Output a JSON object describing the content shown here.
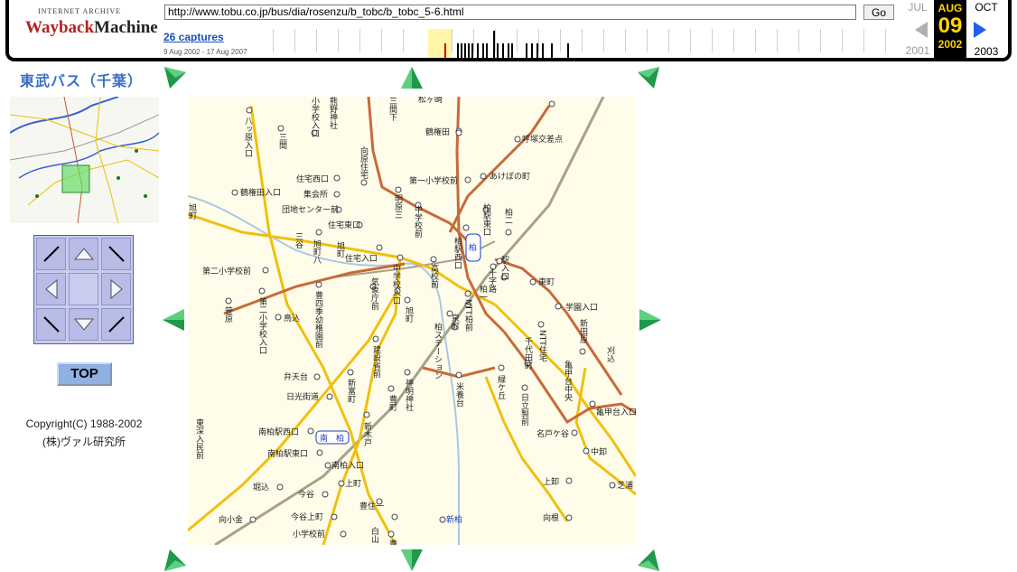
{
  "wayback": {
    "logo_top": "INTERNET ARCHIVE",
    "logo_main_a": "Wayback",
    "logo_main_b": "Machine",
    "url": "http://www.tobu.co.jp/bus/dia/rosenzu/b_tobc/b_tobc_5-6.html",
    "go_label": "Go",
    "captures_label": "26 captures",
    "date_range": "9 Aug 2002 - 17 Aug 2007",
    "prev_month": "JUL",
    "cur_month": "AUG",
    "cur_day": "09",
    "cur_year": "2002",
    "next_month": "OCT",
    "prev_year": "2001",
    "next_year": "2003"
  },
  "page": {
    "title": "東武バス（千葉）",
    "top_button": "TOP",
    "copyright_line1": "Copyright(C) 1988-2002",
    "copyright_line2": "(株)ヴァル研究所"
  },
  "map": {
    "labels_h": [
      "松ヶ崎",
      "鶴権田",
      "呼塚交差点",
      "あけぼの町",
      "第一小学校前",
      "住宅西口",
      "集会所",
      "鶴権田入口",
      "団地センター前",
      "住宅東口",
      "住宅入口",
      "第二小学校前",
      "鳥込",
      "東町",
      "学園入口",
      "弁天台",
      "日光街道",
      "南柏駅西口",
      "南柏駅東口",
      "南柏入口",
      "堀込",
      "今谷",
      "上町",
      "豊住一",
      "向小金",
      "今谷上町",
      "小学校前",
      "亀甲台入口",
      "名戸ケ谷",
      "中卸",
      "上卸",
      "芝浦",
      "向根"
    ],
    "labels_v": [
      "八ッ原入口",
      "三間",
      "小学校入口",
      "熊野神社",
      "向原住宅",
      "明原三",
      "中学校前",
      "三谷",
      "旭町八",
      "旭町",
      "柏駅東口",
      "柏駅西口",
      "高校前",
      "柏二",
      "駅入口",
      "十字路",
      "柏一",
      "NTT柏前",
      "泉町",
      "柏ステーション",
      "豊四季幼稚園前",
      "第二小学校入口",
      "笹原",
      "気象庁前",
      "中学校入口",
      "旭町",
      "建設省前",
      "新富町",
      "豊町",
      "新木戸",
      "東深入民前",
      "神明神社",
      "米養台",
      "緑ケ丘",
      "千代田町",
      "NTT住宅",
      "日立製前",
      "新田原",
      "亀甲台中央",
      "刈込",
      "白山",
      "豊住",
      "三間下",
      "旭町"
    ],
    "station_kashiwa": "柏",
    "station_minamikashiwa": "南　柏",
    "station_shinkashiwa": "新柏"
  }
}
